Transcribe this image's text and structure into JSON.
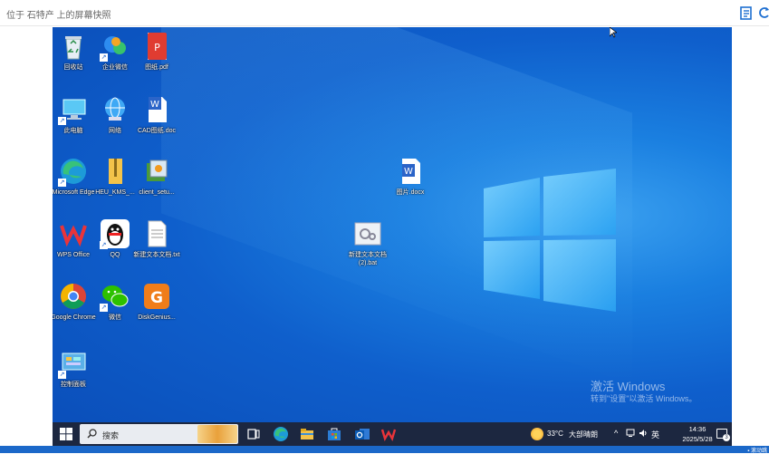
{
  "viewer": {
    "title": "位于 石特产 上的屏幕快照",
    "bottom_text": "▪ 滚动跳"
  },
  "desktop_icons": [
    {
      "label": "回收站",
      "name": "recycle-bin"
    },
    {
      "label": "企业微信",
      "name": "wecom"
    },
    {
      "label": "图纸.pdf",
      "name": "pdf-file"
    },
    {
      "label": "此电脑",
      "name": "this-pc"
    },
    {
      "label": "网络",
      "name": "network"
    },
    {
      "label": "CAD图纸.doc",
      "name": "cad-doc"
    },
    {
      "label": "Microsoft Edge",
      "name": "edge"
    },
    {
      "label": "HEU_KMS_...",
      "name": "heu-kms"
    },
    {
      "label": "client_setu...",
      "name": "client-setup"
    },
    {
      "label": "WPS Office",
      "name": "wps-office"
    },
    {
      "label": "QQ",
      "name": "qq"
    },
    {
      "label": "新建文本文档.txt",
      "name": "new-txt"
    },
    {
      "label": "Google Chrome",
      "name": "chrome"
    },
    {
      "label": "微信",
      "name": "wechat"
    },
    {
      "label": "DiskGenius...",
      "name": "diskgenius"
    },
    {
      "label": "控制面板",
      "name": "control-panel"
    },
    {
      "label": "图片.docx",
      "name": "picture-docx"
    },
    {
      "label": "新建文本文档 (2).bat",
      "name": "new-bat"
    }
  ],
  "watermark": {
    "line1": "激活 Windows",
    "line2": "转到\"设置\"以激活 Windows。"
  },
  "taskbar": {
    "search_label": "搜索",
    "temperature": "33°C",
    "weather": "大部晴朗",
    "tray_caret": "^",
    "tray_ime": "英",
    "time": "14:36",
    "date": "2025/5/28",
    "notification_count": "3"
  },
  "colors": {
    "taskbar": "#1c2740",
    "desktop_accent": "#1a7fe0"
  }
}
